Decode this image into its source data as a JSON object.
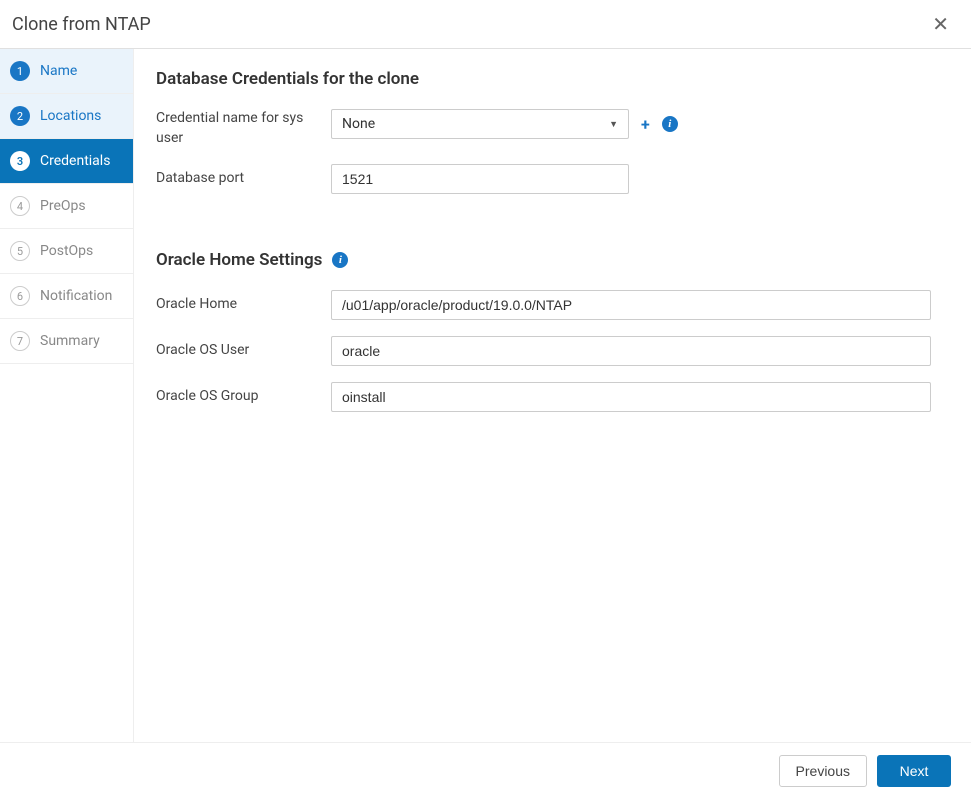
{
  "dialog": {
    "title": "Clone from NTAP"
  },
  "sidebar": {
    "steps": [
      {
        "num": "1",
        "label": "Name"
      },
      {
        "num": "2",
        "label": "Locations"
      },
      {
        "num": "3",
        "label": "Credentials"
      },
      {
        "num": "4",
        "label": "PreOps"
      },
      {
        "num": "5",
        "label": "PostOps"
      },
      {
        "num": "6",
        "label": "Notification"
      },
      {
        "num": "7",
        "label": "Summary"
      }
    ]
  },
  "credentials": {
    "section_title": "Database Credentials for the clone",
    "cred_name_label": "Credential name for sys user",
    "cred_name_value": "None",
    "db_port_label": "Database port",
    "db_port_value": "1521"
  },
  "oracle": {
    "section_title": "Oracle Home Settings",
    "home_label": "Oracle Home",
    "home_value": "/u01/app/oracle/product/19.0.0/NTAP",
    "os_user_label": "Oracle OS User",
    "os_user_value": "oracle",
    "os_group_label": "Oracle OS Group",
    "os_group_value": "oinstall"
  },
  "footer": {
    "previous": "Previous",
    "next": "Next"
  }
}
